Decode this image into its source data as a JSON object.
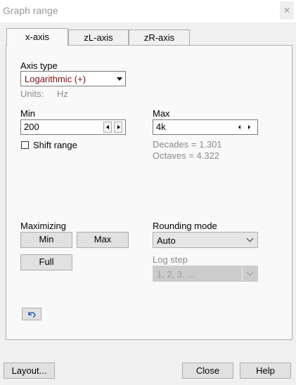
{
  "window": {
    "title": "Graph range",
    "close_label": "✕"
  },
  "tabs": [
    {
      "label": "x-axis",
      "active": true
    },
    {
      "label": "zL-axis",
      "active": false
    },
    {
      "label": "zR-axis",
      "active": false
    }
  ],
  "axis": {
    "type_label": "Axis type",
    "type_value": "Logarithmic (+)",
    "units_label": "Units:",
    "units_value": "Hz"
  },
  "min": {
    "label": "Min",
    "value": "200"
  },
  "max": {
    "label": "Max",
    "value": "4k"
  },
  "shift_range": {
    "label": "Shift range",
    "checked": false
  },
  "decades": "Decades = 1.301",
  "octaves": "Octaves = 4.322",
  "maximizing": {
    "label": "Maximizing",
    "min_button": "Min",
    "max_button": "Max",
    "full_button": "Full"
  },
  "rounding": {
    "label": "Rounding mode",
    "value": "Auto"
  },
  "log_step": {
    "label": "Log step",
    "value": "1, 2, 3, ..."
  },
  "undo_icon": "undo-arrow-icon",
  "footer": {
    "layout_button": "Layout...",
    "close_button": "Close",
    "help_button": "Help"
  },
  "colors": {
    "combo_text": "#7a1010",
    "disabled_text": "#8a8a8a",
    "undo_arrow": "#1f4fbf"
  }
}
